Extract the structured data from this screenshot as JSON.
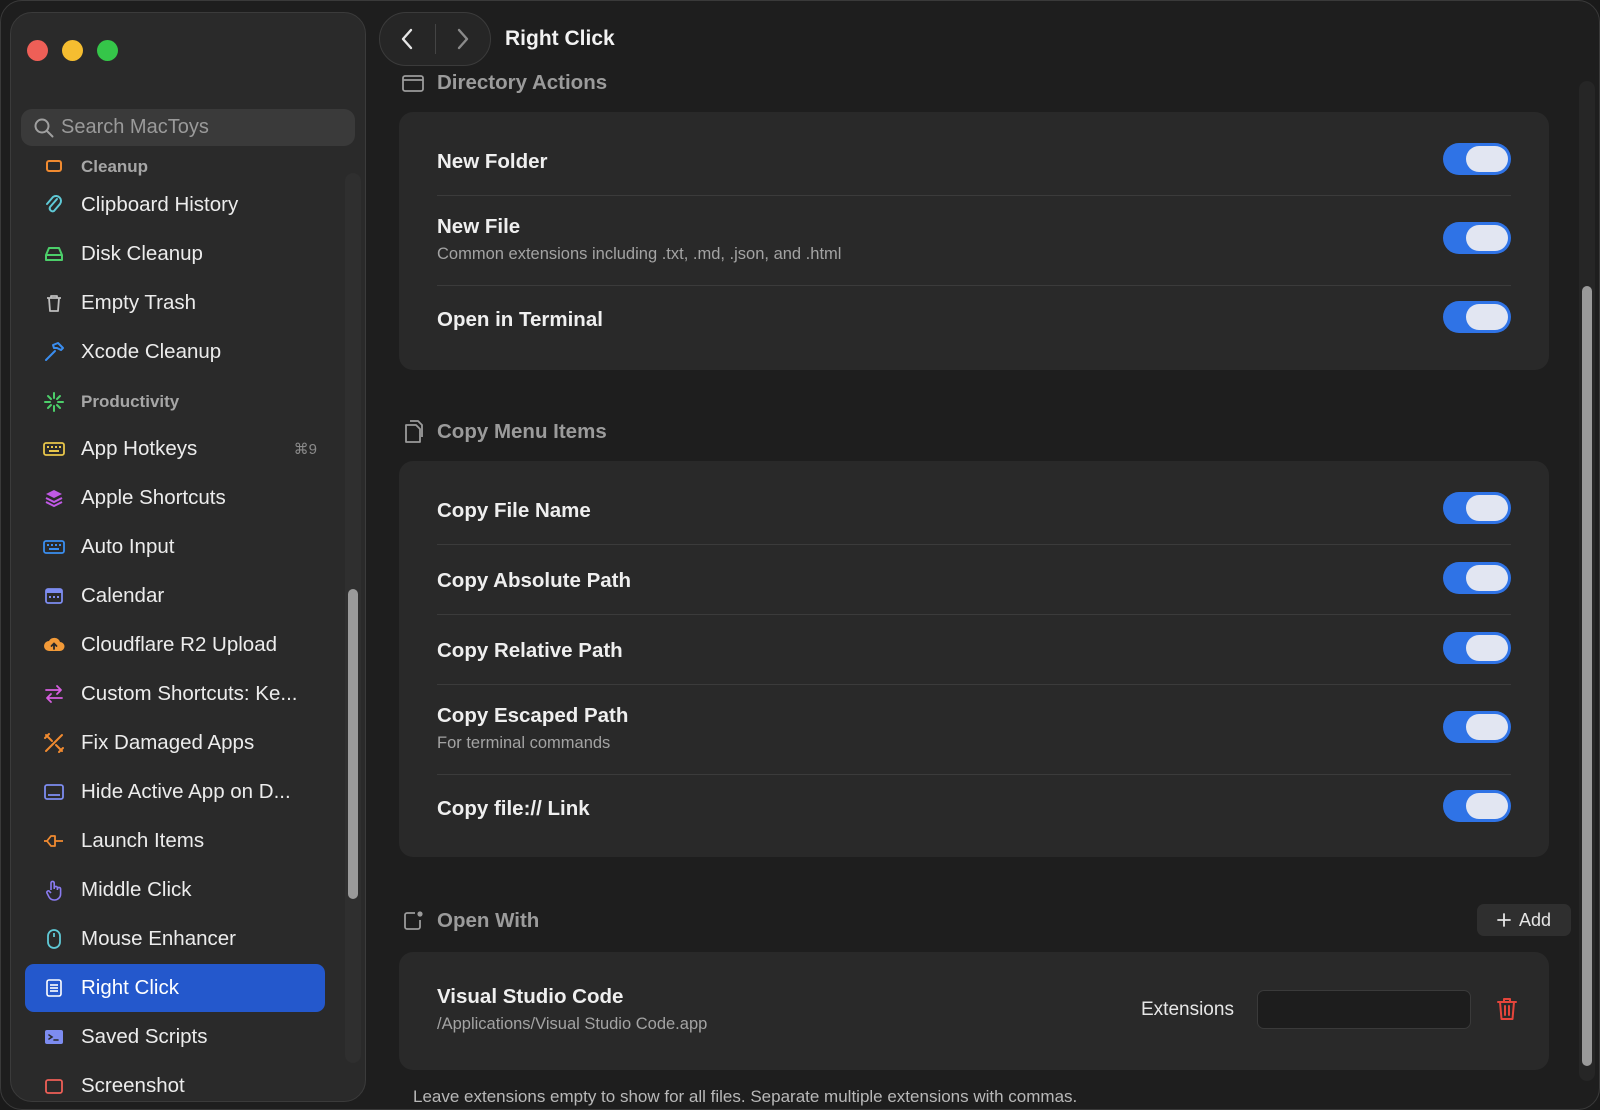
{
  "sidebar": {
    "search_placeholder": "Search MacToys",
    "partial_top_label": "Cleanup",
    "items_cleanup": [
      {
        "label": "Clipboard History",
        "icon": "paperclip-icon",
        "color": "#5fc9d6"
      },
      {
        "label": "Disk Cleanup",
        "icon": "disk-icon",
        "color": "#4ccf6a"
      },
      {
        "label": "Empty Trash",
        "icon": "trash-icon",
        "color": "#bdbdbd"
      },
      {
        "label": "Xcode Cleanup",
        "icon": "hammer-icon",
        "color": "#3a8ef0"
      }
    ],
    "section_productivity": "Productivity",
    "items_productivity": [
      {
        "label": "App Hotkeys",
        "icon": "keyboard-icon",
        "color": "#e8c64a",
        "shortcut": "⌘9"
      },
      {
        "label": "Apple Shortcuts",
        "icon": "layers-icon",
        "color": "#c159e6"
      },
      {
        "label": "Auto Input",
        "icon": "keyboard-icon",
        "color": "#3a8ef0"
      },
      {
        "label": "Calendar",
        "icon": "calendar-icon",
        "color": "#7d8cf0"
      },
      {
        "label": "Cloudflare R2 Upload",
        "icon": "cloud-upload-icon",
        "color": "#f29a38"
      },
      {
        "label": "Custom Shortcuts: Ke...",
        "icon": "arrows-icon",
        "color": "#d65ee0"
      },
      {
        "label": "Fix Damaged Apps",
        "icon": "tools-icon",
        "color": "#f08a30"
      },
      {
        "label": "Hide Active App on D...",
        "icon": "dock-icon",
        "color": "#7d8cf0"
      },
      {
        "label": "Launch Items",
        "icon": "launch-icon",
        "color": "#f08a30"
      },
      {
        "label": "Middle Click",
        "icon": "pointer-icon",
        "color": "#8a7bf0"
      },
      {
        "label": "Mouse Enhancer",
        "icon": "mouse-icon",
        "color": "#5fc9d6"
      },
      {
        "label": "Right Click",
        "icon": "menu-icon",
        "color": "#ffffff",
        "active": true
      },
      {
        "label": "Saved Scripts",
        "icon": "terminal-icon",
        "color": "#7d8cf0"
      },
      {
        "label": "Screenshot",
        "icon": "screenshot-icon",
        "color": "#ee5f57"
      }
    ]
  },
  "header": {
    "title": "Right Click"
  },
  "directory_actions": {
    "title": "Directory Actions",
    "rows": [
      {
        "label": "New Folder",
        "sub": "",
        "on": true
      },
      {
        "label": "New File",
        "sub": "Common extensions including .txt, .md, .json, and .html",
        "on": true
      },
      {
        "label": "Open in Terminal",
        "sub": "",
        "on": true
      }
    ]
  },
  "copy_menu": {
    "title": "Copy Menu Items",
    "rows": [
      {
        "label": "Copy File Name",
        "sub": "",
        "on": true
      },
      {
        "label": "Copy Absolute Path",
        "sub": "",
        "on": true
      },
      {
        "label": "Copy Relative Path",
        "sub": "",
        "on": true
      },
      {
        "label": "Copy Escaped Path",
        "sub": "For terminal commands",
        "on": true
      },
      {
        "label": "Copy file:// Link",
        "sub": "",
        "on": true
      }
    ]
  },
  "open_with": {
    "title": "Open With",
    "add_label": "Add",
    "app": {
      "name": "Visual Studio Code",
      "path": "/Applications/Visual Studio Code.app",
      "extensions_label": "Extensions",
      "extensions_value": ""
    },
    "note": "Leave extensions empty to show for all files. Separate multiple extensions with commas."
  },
  "colors": {
    "accent": "#2f73e6",
    "selection": "#2458cc",
    "delete": "#e5453b"
  }
}
